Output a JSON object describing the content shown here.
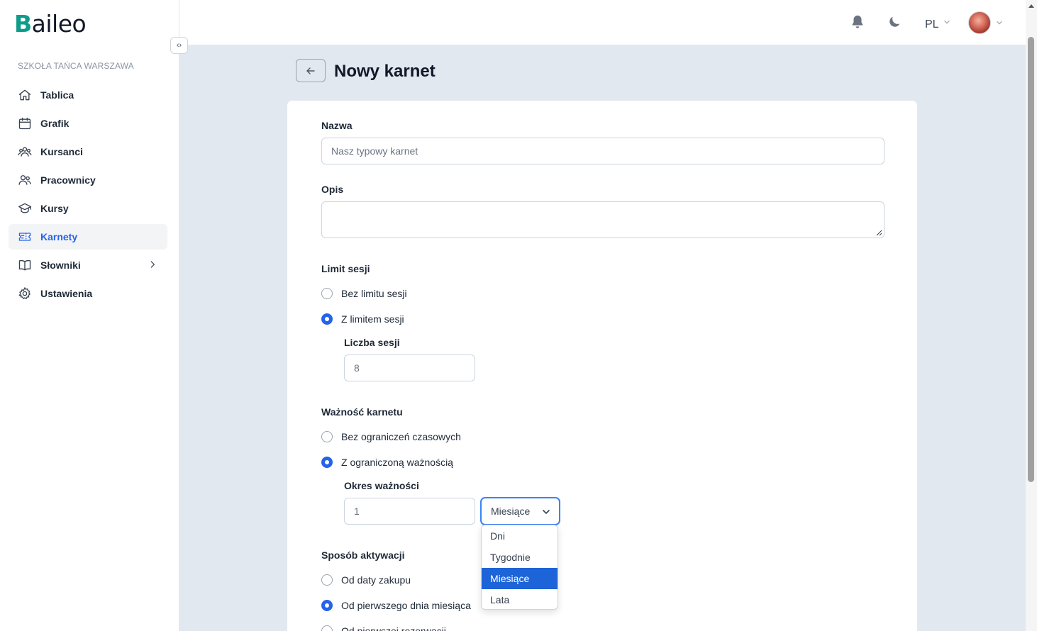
{
  "brand": {
    "logo_first": "B",
    "logo_rest": "aileo"
  },
  "sidebar": {
    "org_name": "SZKOŁA TAŃCA WARSZAWA",
    "items": [
      {
        "label": "Tablica",
        "icon": "home-icon"
      },
      {
        "label": "Grafik",
        "icon": "calendar-icon"
      },
      {
        "label": "Kursanci",
        "icon": "students-icon"
      },
      {
        "label": "Pracownicy",
        "icon": "employees-icon"
      },
      {
        "label": "Kursy",
        "icon": "graduation-cap-icon"
      },
      {
        "label": "Karnety",
        "icon": "ticket-icon",
        "active": true
      },
      {
        "label": "Słowniki",
        "icon": "book-icon",
        "has_children": true
      },
      {
        "label": "Ustawienia",
        "icon": "gear-icon"
      }
    ]
  },
  "topbar": {
    "language": "PL"
  },
  "page": {
    "title": "Nowy karnet"
  },
  "form": {
    "name_label": "Nazwa",
    "name_value": "Nasz typowy karnet",
    "description_label": "Opis",
    "description_value": "",
    "session_limit": {
      "label": "Limit sesji",
      "options": [
        "Bez limitu sesji",
        "Z limitem sesji"
      ],
      "selected": "Z limitem sesji",
      "count_label": "Liczba sesji",
      "count_value": "8"
    },
    "validity": {
      "label": "Ważność karnetu",
      "options": [
        "Bez ograniczeń czasowych",
        "Z ograniczoną ważnością"
      ],
      "selected": "Z ograniczoną ważnością",
      "period_label": "Okres ważności",
      "period_value": "1",
      "unit_selected": "Miesiące",
      "unit_options": [
        "Dni",
        "Tygodnie",
        "Miesiące",
        "Lata"
      ]
    },
    "activation": {
      "label": "Sposób aktywacji",
      "options": [
        "Od daty zakupu",
        "Od pierwszego dnia miesiąca",
        "Od pierwszej rezerwacji"
      ],
      "selected": "Od pierwszego dnia miesiąca"
    }
  },
  "colors": {
    "accent": "#2563eb",
    "brand": "#0f9d8a",
    "main_bg": "#e2e8f0"
  }
}
